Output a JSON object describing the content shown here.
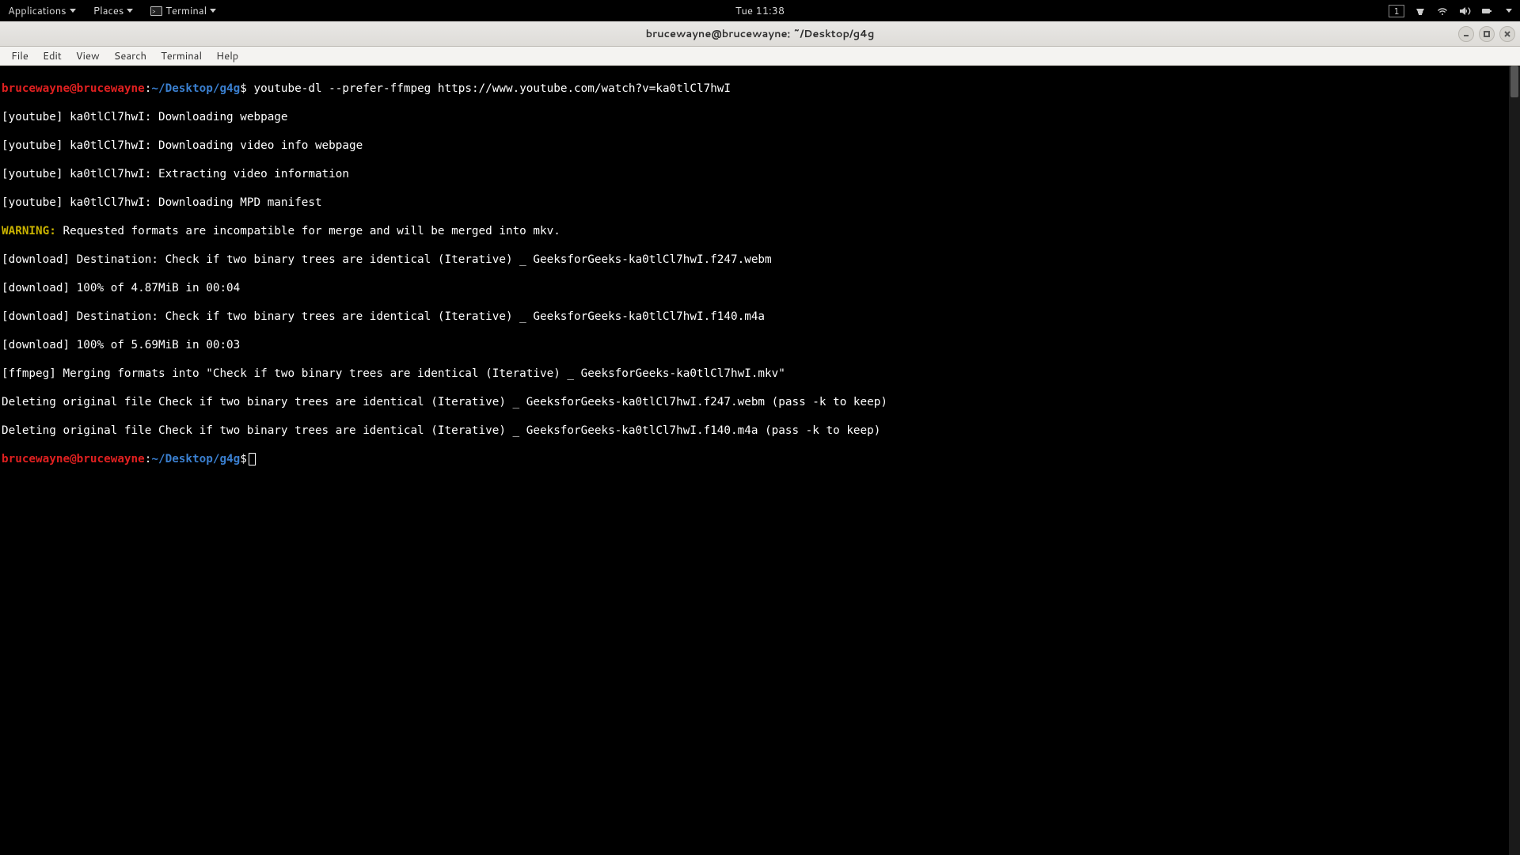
{
  "topbar": {
    "applications": "Applications",
    "places": "Places",
    "terminal": "Terminal",
    "clock": "Tue 11:38",
    "workspace": "1"
  },
  "window": {
    "title": "brucewayne@brucewayne: ~/Desktop/g4g"
  },
  "menubar": {
    "file": "File",
    "edit": "Edit",
    "view": "View",
    "search": "Search",
    "terminal": "Terminal",
    "help": "Help"
  },
  "prompt": {
    "user": "brucewayne@brucewayne",
    "colon": ":",
    "path": "~/Desktop/g4g",
    "dollar": "$"
  },
  "command": "youtube-dl --prefer-ffmpeg https://www.youtube.com/watch?v=ka0tlCl7hwI",
  "output": {
    "l1": "[youtube] ka0tlCl7hwI: Downloading webpage",
    "l2": "[youtube] ka0tlCl7hwI: Downloading video info webpage",
    "l3": "[youtube] ka0tlCl7hwI: Extracting video information",
    "l4": "[youtube] ka0tlCl7hwI: Downloading MPD manifest",
    "warn_label": "WARNING:",
    "warn_text": " Requested formats are incompatible for merge and will be merged into mkv.",
    "l6": "[download] Destination: Check if two binary trees are identical (Iterative) _ GeeksforGeeks-ka0tlCl7hwI.f247.webm",
    "l7": "[download] 100% of 4.87MiB in 00:04",
    "l8": "[download] Destination: Check if two binary trees are identical (Iterative) _ GeeksforGeeks-ka0tlCl7hwI.f140.m4a",
    "l9": "[download] 100% of 5.69MiB in 00:03",
    "l10": "[ffmpeg] Merging formats into \"Check if two binary trees are identical (Iterative) _ GeeksforGeeks-ka0tlCl7hwI.mkv\"",
    "l11": "Deleting original file Check if two binary trees are identical (Iterative) _ GeeksforGeeks-ka0tlCl7hwI.f247.webm (pass -k to keep)",
    "l12": "Deleting original file Check if two binary trees are identical (Iterative) _ GeeksforGeeks-ka0tlCl7hwI.f140.m4a (pass -k to keep)"
  }
}
